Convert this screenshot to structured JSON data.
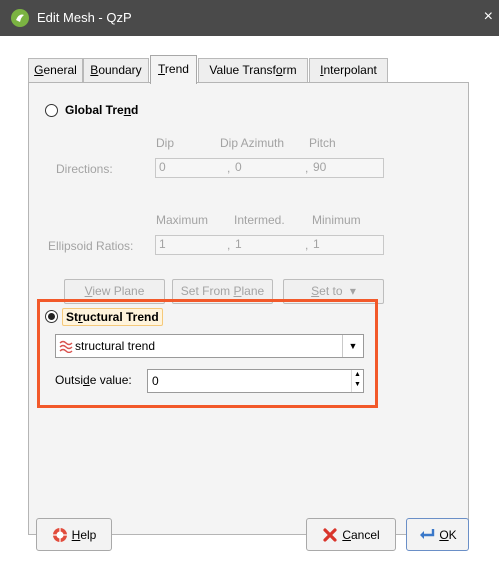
{
  "window": {
    "title": "Edit Mesh - QzP",
    "close_glyph": "×"
  },
  "tabs": [
    {
      "label_pre": "",
      "label_key": "G",
      "label_post": "eneral",
      "active": false
    },
    {
      "label_pre": "",
      "label_key": "B",
      "label_post": "oundary",
      "active": false
    },
    {
      "label_pre": "",
      "label_key": "T",
      "label_post": "rend",
      "active": true
    },
    {
      "label_pre": "Value Transf",
      "label_key": "o",
      "label_post": "rm",
      "active": false
    },
    {
      "label_pre": "",
      "label_key": "I",
      "label_post": "nterpolant",
      "active": false
    }
  ],
  "global_trend": {
    "label_pre": "Global Tre",
    "label_key": "n",
    "label_post": "d",
    "selected": false,
    "directions": {
      "label": "Directions:",
      "headers": [
        "Dip",
        "Dip Azimuth",
        "Pitch"
      ],
      "values": [
        "0",
        "0",
        "90"
      ],
      "separator": ","
    },
    "ellipsoid": {
      "label": "Ellipsoid Ratios:",
      "headers": [
        "Maximum",
        "Intermed.",
        "Minimum"
      ],
      "values": [
        "1",
        "1",
        "1"
      ],
      "separator": ","
    },
    "buttons": {
      "view_plane_key": "V",
      "view_plane_post": "iew Plane",
      "set_from_plane_pre": "Set From ",
      "set_from_plane_key": "P",
      "set_from_plane_post": "lane",
      "set_to_key": "S",
      "set_to_post": "et to",
      "set_to_arrow": "▾"
    }
  },
  "structural_trend": {
    "label_pre": "St",
    "label_key": "r",
    "label_post": "uctural Trend",
    "selected": true,
    "selected_value": "structural trend",
    "dropdown_arrow": "▼",
    "outside_label_pre": "Outsi",
    "outside_label_key": "d",
    "outside_label_post": "e value:",
    "outside_value": "0",
    "spin_up": "▲",
    "spin_down": "▼",
    "highlight_color": "#f2592a"
  },
  "footer": {
    "help_key": "H",
    "help_post": "elp",
    "cancel_key": "C",
    "cancel_post": "ancel",
    "ok_key": "O",
    "ok_post": "K"
  }
}
